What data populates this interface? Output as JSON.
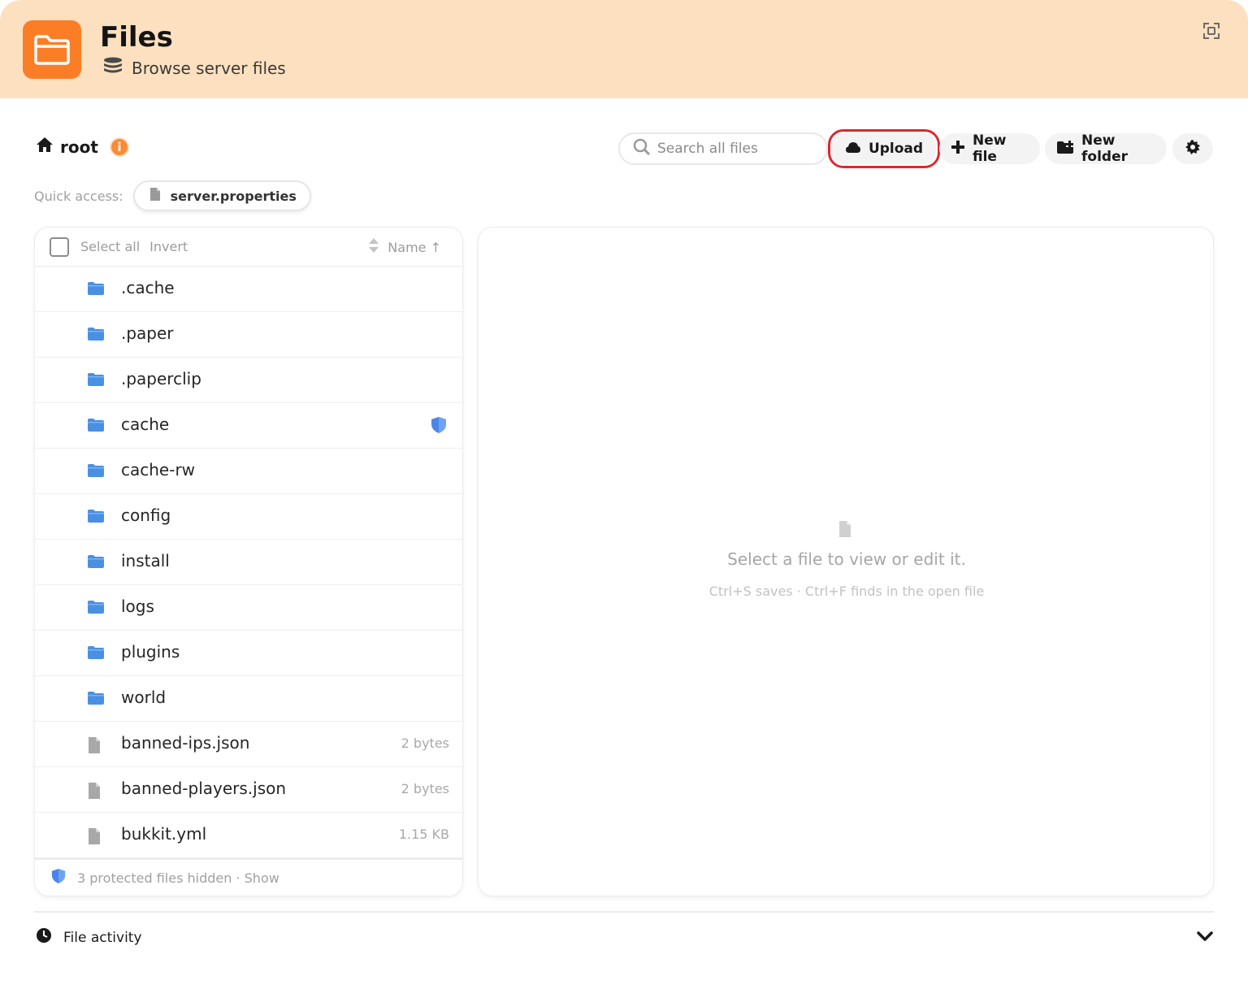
{
  "header": {
    "title": "Files",
    "subtitle": "Browse server files"
  },
  "toolbar": {
    "breadcrumb": "root",
    "info_badge": "i",
    "search_placeholder": "Search all files",
    "upload_label": "Upload",
    "new_file_label": "New file",
    "new_folder_label": "New folder"
  },
  "quick_access": {
    "label": "Quick access:",
    "items": [
      "server.properties"
    ]
  },
  "file_list": {
    "select_all": "Select all",
    "invert": "Invert",
    "sort_label": "Name ↑",
    "entries": [
      {
        "name": ".cache",
        "type": "folder",
        "size": ""
      },
      {
        "name": ".paper",
        "type": "folder",
        "size": ""
      },
      {
        "name": ".paperclip",
        "type": "folder",
        "size": ""
      },
      {
        "name": "cache",
        "type": "folder",
        "size": "",
        "protected": true
      },
      {
        "name": "cache-rw",
        "type": "folder",
        "size": ""
      },
      {
        "name": "config",
        "type": "folder",
        "size": ""
      },
      {
        "name": "install",
        "type": "folder",
        "size": ""
      },
      {
        "name": "logs",
        "type": "folder",
        "size": ""
      },
      {
        "name": "plugins",
        "type": "folder",
        "size": ""
      },
      {
        "name": "world",
        "type": "folder",
        "size": ""
      },
      {
        "name": "banned-ips.json",
        "type": "file",
        "size": "2 bytes"
      },
      {
        "name": "banned-players.json",
        "type": "file",
        "size": "2 bytes"
      },
      {
        "name": "bukkit.yml",
        "type": "file",
        "size": "1.15 KB"
      }
    ],
    "footer": "3 protected files hidden · Show"
  },
  "viewer": {
    "message": "Select a file to view or edit it.",
    "hint": "Ctrl+S saves · Ctrl+F finds in the open file"
  },
  "activity": {
    "label": "File activity"
  },
  "colors": {
    "header_bg": "#fde0bf",
    "accent": "#fb7e27",
    "folder": "#4a90e2",
    "highlight": "#e0262f"
  }
}
